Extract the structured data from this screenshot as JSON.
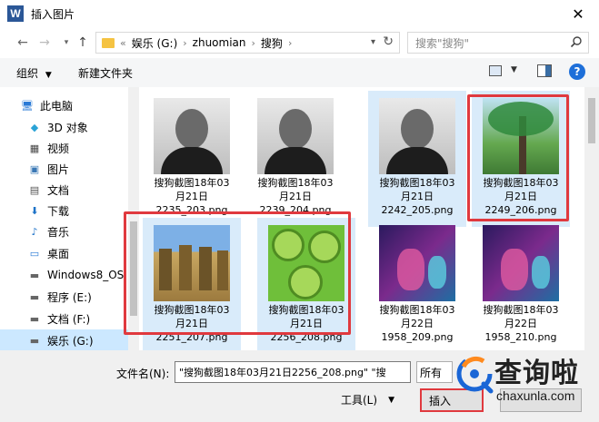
{
  "window": {
    "title": "插入图片",
    "app_icon": "W"
  },
  "nav": {
    "breadcrumb": [
      "«",
      "娱乐 (G:)",
      "zhuomian",
      "搜狗"
    ],
    "search_placeholder": "搜索\"搜狗\""
  },
  "toolbar": {
    "organize": "组织",
    "new_folder": "新建文件夹"
  },
  "sidebar": {
    "items": [
      {
        "label": "此电脑",
        "icon": "computer-icon"
      },
      {
        "label": "3D 对象",
        "icon": "cube-icon"
      },
      {
        "label": "视频",
        "icon": "video-icon"
      },
      {
        "label": "图片",
        "icon": "picture-icon"
      },
      {
        "label": "文档",
        "icon": "document-icon"
      },
      {
        "label": "下载",
        "icon": "download-icon"
      },
      {
        "label": "音乐",
        "icon": "music-icon"
      },
      {
        "label": "桌面",
        "icon": "desktop-icon"
      },
      {
        "label": "Windows8_OS",
        "icon": "drive-icon"
      },
      {
        "label": "程序 (E:)",
        "icon": "drive-icon"
      },
      {
        "label": "文档 (F:)",
        "icon": "drive-icon"
      },
      {
        "label": "娱乐 (G:)",
        "icon": "drive-icon"
      }
    ]
  },
  "files": [
    {
      "line1": "搜狗截图18年03",
      "line2": "月21日",
      "line3": "2235_203.png",
      "selected": false,
      "icon": "portrait-photo"
    },
    {
      "line1": "搜狗截图18年03",
      "line2": "月21日",
      "line3": "2239_204.png",
      "selected": false,
      "icon": "portrait-photo"
    },
    {
      "line1": "搜狗截图18年03",
      "line2": "月21日",
      "line3": "2242_205.png",
      "selected": true,
      "icon": "portrait-photo"
    },
    {
      "line1": "搜狗截图18年03",
      "line2": "月21日",
      "line3": "2249_206.png",
      "selected": true,
      "icon": "tree-photo"
    },
    {
      "line1": "搜狗截图18年03",
      "line2": "月21日",
      "line3": "2251_207.png",
      "selected": true,
      "icon": "haystack-photo"
    },
    {
      "line1": "搜狗截图18年03",
      "line2": "月21日",
      "line3": "2256_208.png",
      "selected": true,
      "icon": "kiwi-photo"
    },
    {
      "line1": "搜狗截图18年03",
      "line2": "月22日",
      "line3": "1958_209.png",
      "selected": false,
      "icon": "game-screenshot"
    },
    {
      "line1": "搜狗截图18年03",
      "line2": "月22日",
      "line3": "1958_210.png",
      "selected": false,
      "icon": "game-screenshot"
    }
  ],
  "bottom": {
    "filename_label": "文件名(N):",
    "filename_value": "\"搜狗截图18年03月21日2256_208.png\" \"搜",
    "type_label": "所有",
    "tools_label": "工具(L)",
    "insert_label": "插入"
  },
  "watermark": {
    "brand": "查询啦",
    "url": "chaxunla.com"
  },
  "colors": {
    "highlight": "#e0393e",
    "selection": "#cce8ff",
    "brand": "#2b5797"
  }
}
